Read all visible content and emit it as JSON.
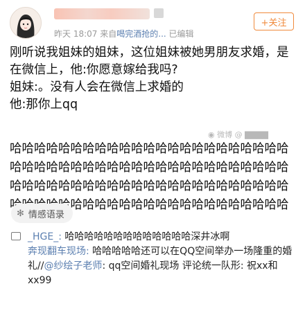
{
  "header": {
    "meta_time": "昨天 18:07",
    "meta_from": "来自",
    "meta_source": "喝完酒抢的...",
    "meta_edited": "已编辑",
    "follow_label": "+关注"
  },
  "post": {
    "lines": [
      "刚听说我姐妹的姐妹，这位姐妹被她男朋友求婚，是在微信上，他:你愿意嫁给我吗?",
      "姐妹:。没有人会在微信上求婚的",
      "他:那你上qq"
    ],
    "laugh": "哈哈哈哈哈哈哈哈哈哈哈哈哈哈哈哈哈哈哈哈哈哈哈哈哈哈哈哈哈哈哈哈哈哈哈哈哈哈哈哈哈哈哈哈哈哈哈哈哈哈哈哈哈哈哈哈哈哈哈哈哈哈哈哈哈哈哈哈哈哈哈哈哈哈哈哈哈哈哈哈哈哈哈哈哈哈哈哈哈哈哈哈"
  },
  "tag": {
    "label": "情感语录"
  },
  "comment": {
    "user1": "_HGE_:",
    "text1": " 哈哈哈哈哈哈哈哈哈哈哈哈哈深井冰啊",
    "user2": "奔现翻车现场:",
    "text2": " 哈哈哈哈哈还可以在QQ空间举办一场隆重的婚礼//",
    "mention": "@纱绘子老师",
    "text3": ": qq空间婚礼现场 评论统一队形: 祝xx和xx99"
  }
}
